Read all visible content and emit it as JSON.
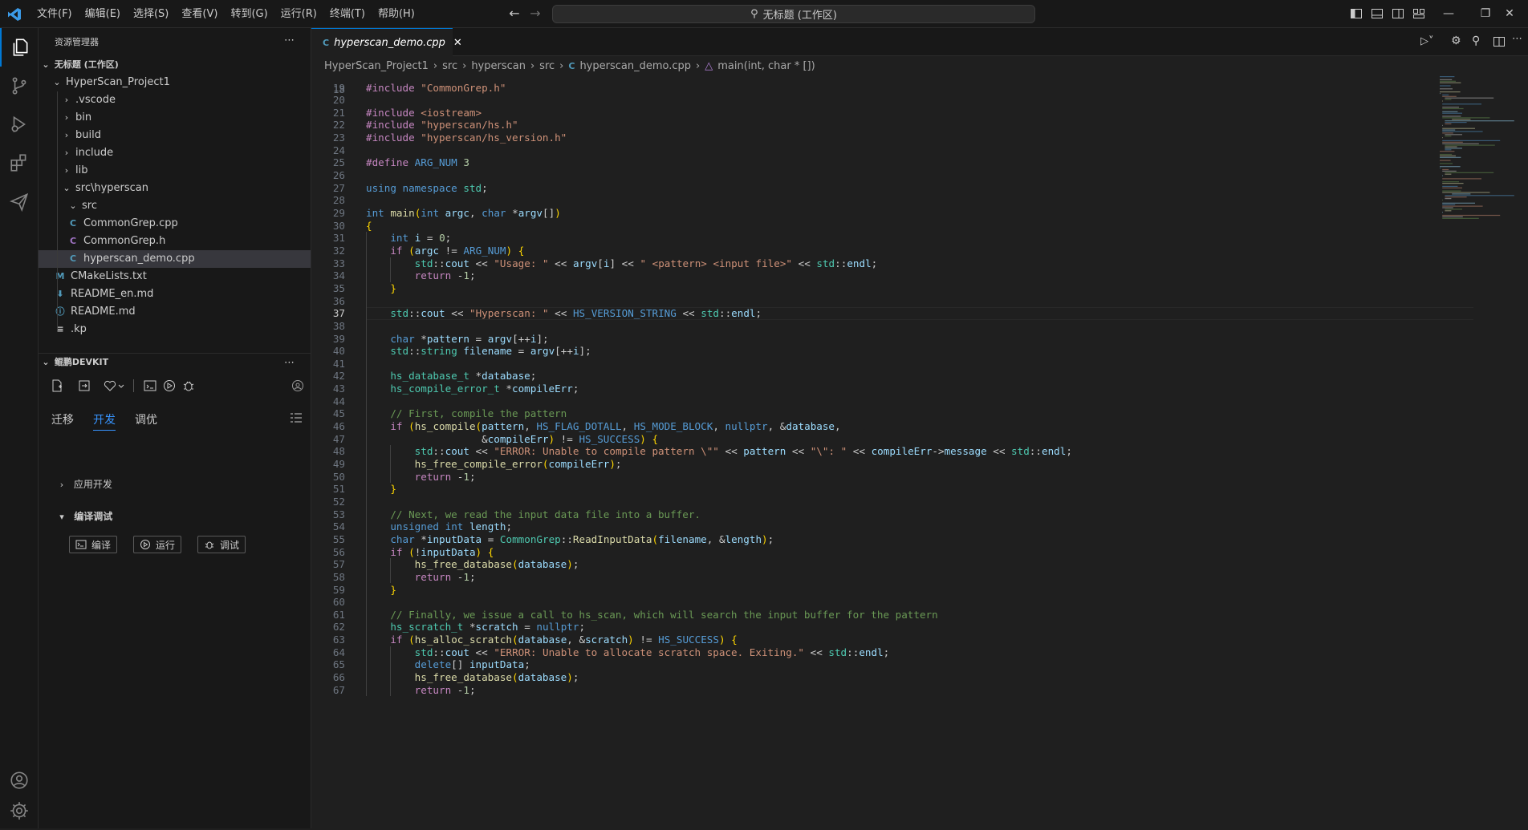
{
  "menu": [
    "文件(F)",
    "编辑(E)",
    "选择(S)",
    "查看(V)",
    "转到(G)",
    "运行(R)",
    "终端(T)",
    "帮助(H)"
  ],
  "command_center": "无标题 (工作区)",
  "explorer": {
    "title": "资源管理器",
    "workspace": "无标题 (工作区)",
    "items": [
      {
        "label": "HyperScan_Project1",
        "kind": "folder-open"
      },
      {
        "label": ".vscode",
        "kind": "folder"
      },
      {
        "label": "bin",
        "kind": "folder"
      },
      {
        "label": "build",
        "kind": "folder"
      },
      {
        "label": "include",
        "kind": "folder"
      },
      {
        "label": "lib",
        "kind": "folder"
      },
      {
        "label": "src\\hyperscan",
        "kind": "folder-open"
      },
      {
        "label": "src",
        "kind": "folder-open"
      },
      {
        "label": "CommonGrep.cpp",
        "kind": "cpp"
      },
      {
        "label": "CommonGrep.h",
        "kind": "h"
      },
      {
        "label": "hyperscan_demo.cpp",
        "kind": "cpp"
      },
      {
        "label": "CMakeLists.txt",
        "kind": "cmake"
      },
      {
        "label": "README_en.md",
        "kind": "md"
      },
      {
        "label": "README.md",
        "kind": "info"
      },
      {
        "label": ".kp",
        "kind": "text"
      }
    ]
  },
  "devkit": {
    "title": "鲲鹏DEVKIT",
    "tabs": [
      "迁移",
      "开发",
      "调优"
    ],
    "active_tab": "开发",
    "sections": [
      "应用开发",
      "编译调试"
    ],
    "buttons": [
      "编译",
      "运行",
      "调试"
    ]
  },
  "editor": {
    "tab_label": "hyperscan_demo.cpp",
    "breadcrumb": [
      "HyperScan_Project1",
      "src",
      "hyperscan",
      "src",
      "hyperscan_demo.cpp",
      "main(int, char * [])"
    ],
    "partial_line": "18",
    "current_line": 37,
    "lines": [
      {
        "n": "19",
        "t": "#include \"CommonGrep.h\""
      },
      {
        "n": "20",
        "t": ""
      },
      {
        "n": "21",
        "t": "#include <iostream>"
      },
      {
        "n": "22",
        "t": "#include \"hyperscan/hs.h\""
      },
      {
        "n": "23",
        "t": "#include \"hyperscan/hs_version.h\""
      },
      {
        "n": "24",
        "t": ""
      },
      {
        "n": "25",
        "t": "#define ARG_NUM 3"
      },
      {
        "n": "26",
        "t": ""
      },
      {
        "n": "27",
        "t": "using namespace std;"
      },
      {
        "n": "28",
        "t": ""
      },
      {
        "n": "29",
        "t": "int main(int argc, char *argv[])"
      },
      {
        "n": "30",
        "t": "{"
      },
      {
        "n": "31",
        "t": "    int i = 0;"
      },
      {
        "n": "32",
        "t": "    if (argc != ARG_NUM) {"
      },
      {
        "n": "33",
        "t": "        std::cout << \"Usage: \" << argv[i] << \" <pattern> <input file>\" << std::endl;"
      },
      {
        "n": "34",
        "t": "        return -1;"
      },
      {
        "n": "35",
        "t": "    }"
      },
      {
        "n": "36",
        "t": ""
      },
      {
        "n": "37",
        "t": "    std::cout << \"Hyperscan: \" << HS_VERSION_STRING << std::endl;"
      },
      {
        "n": "38",
        "t": ""
      },
      {
        "n": "39",
        "t": "    char *pattern = argv[++i];"
      },
      {
        "n": "40",
        "t": "    std::string filename = argv[++i];"
      },
      {
        "n": "41",
        "t": ""
      },
      {
        "n": "42",
        "t": "    hs_database_t *database;"
      },
      {
        "n": "43",
        "t": "    hs_compile_error_t *compileErr;"
      },
      {
        "n": "44",
        "t": ""
      },
      {
        "n": "45",
        "t": "    // First, compile the pattern"
      },
      {
        "n": "46",
        "t": "    if (hs_compile(pattern, HS_FLAG_DOTALL, HS_MODE_BLOCK, nullptr, &database,"
      },
      {
        "n": "47",
        "t": "                   &compileErr) != HS_SUCCESS) {"
      },
      {
        "n": "48",
        "t": "        std::cout << \"ERROR: Unable to compile pattern \\\"\" << pattern << \"\\\": \" << compileErr->message << std::endl;"
      },
      {
        "n": "49",
        "t": "        hs_free_compile_error(compileErr);"
      },
      {
        "n": "50",
        "t": "        return -1;"
      },
      {
        "n": "51",
        "t": "    }"
      },
      {
        "n": "52",
        "t": ""
      },
      {
        "n": "53",
        "t": "    // Next, we read the input data file into a buffer."
      },
      {
        "n": "54",
        "t": "    unsigned int length;"
      },
      {
        "n": "55",
        "t": "    char *inputData = CommonGrep::ReadInputData(filename, &length);"
      },
      {
        "n": "56",
        "t": "    if (!inputData) {"
      },
      {
        "n": "57",
        "t": "        hs_free_database(database);"
      },
      {
        "n": "58",
        "t": "        return -1;"
      },
      {
        "n": "59",
        "t": "    }"
      },
      {
        "n": "60",
        "t": ""
      },
      {
        "n": "61",
        "t": "    // Finally, we issue a call to hs_scan, which will search the input buffer for the pattern"
      },
      {
        "n": "62",
        "t": "    hs_scratch_t *scratch = nullptr;"
      },
      {
        "n": "63",
        "t": "    if (hs_alloc_scratch(database, &scratch) != HS_SUCCESS) {"
      },
      {
        "n": "64",
        "t": "        std::cout << \"ERROR: Unable to allocate scratch space. Exiting.\" << std::endl;"
      },
      {
        "n": "65",
        "t": "        delete[] inputData;"
      },
      {
        "n": "66",
        "t": "        hs_free_database(database);"
      },
      {
        "n": "67",
        "t": "        return -1;"
      }
    ]
  },
  "colors": {
    "accent": "#0078d4",
    "keyword": "#569cd6",
    "control": "#c586c0",
    "string": "#ce9178",
    "comment": "#6a9955",
    "type": "#4ec9b0",
    "function": "#dcdcaa",
    "variable": "#9cdcfe",
    "number": "#b5cea8",
    "macro": "#569cd6"
  }
}
